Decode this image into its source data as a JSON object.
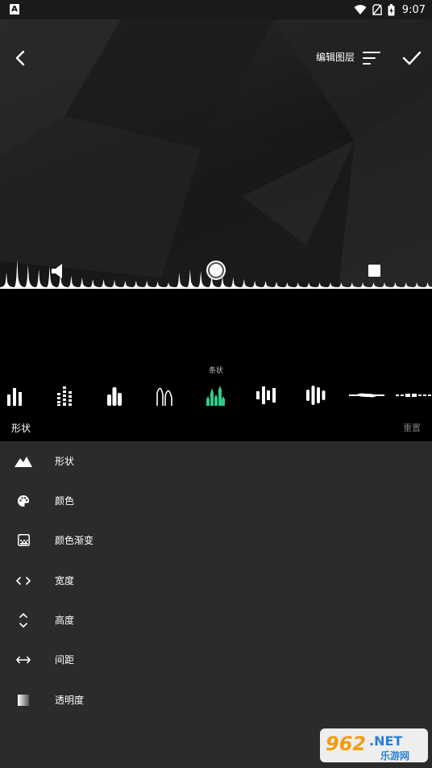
{
  "toolbar": {
    "title": "编辑图层",
    "back_icon": "chevron-left-icon",
    "sort_icon": "sort-lines-icon",
    "confirm_icon": "checkmark-icon"
  },
  "status_bar": {
    "time": "9:07",
    "notification_letter": "A"
  },
  "shape_picker": {
    "selected_caption": "条状",
    "selected_index": 4,
    "accent_color": "#2ecc8a",
    "items": [
      "bars-icon",
      "segmented-bars-icon",
      "rounded-bars-icon",
      "line-peaks-icon",
      "spike-bars-icon",
      "mirror-bars-icon",
      "capsule-bars-icon",
      "line-wave-icon",
      "dashed-wave-icon"
    ]
  },
  "section": {
    "label": "形状",
    "reset_label": "重置"
  },
  "menu": {
    "items": [
      {
        "label": "形状",
        "icon": "mountain-icon",
        "active": true
      },
      {
        "label": "颜色",
        "icon": "palette-icon",
        "active": false
      },
      {
        "label": "颜色渐变",
        "icon": "gradient-icon",
        "active": false
      },
      {
        "label": "宽度",
        "icon": "width-arrows-icon",
        "active": false
      },
      {
        "label": "高度",
        "icon": "height-arrows-icon",
        "active": false
      },
      {
        "label": "间距",
        "icon": "spacing-arrows-icon",
        "active": false
      },
      {
        "label": "透明度",
        "icon": "opacity-icon",
        "active": false
      }
    ]
  },
  "watermark": {
    "brand": "962",
    "suffix": ".NET",
    "subtitle": "乐游网"
  }
}
